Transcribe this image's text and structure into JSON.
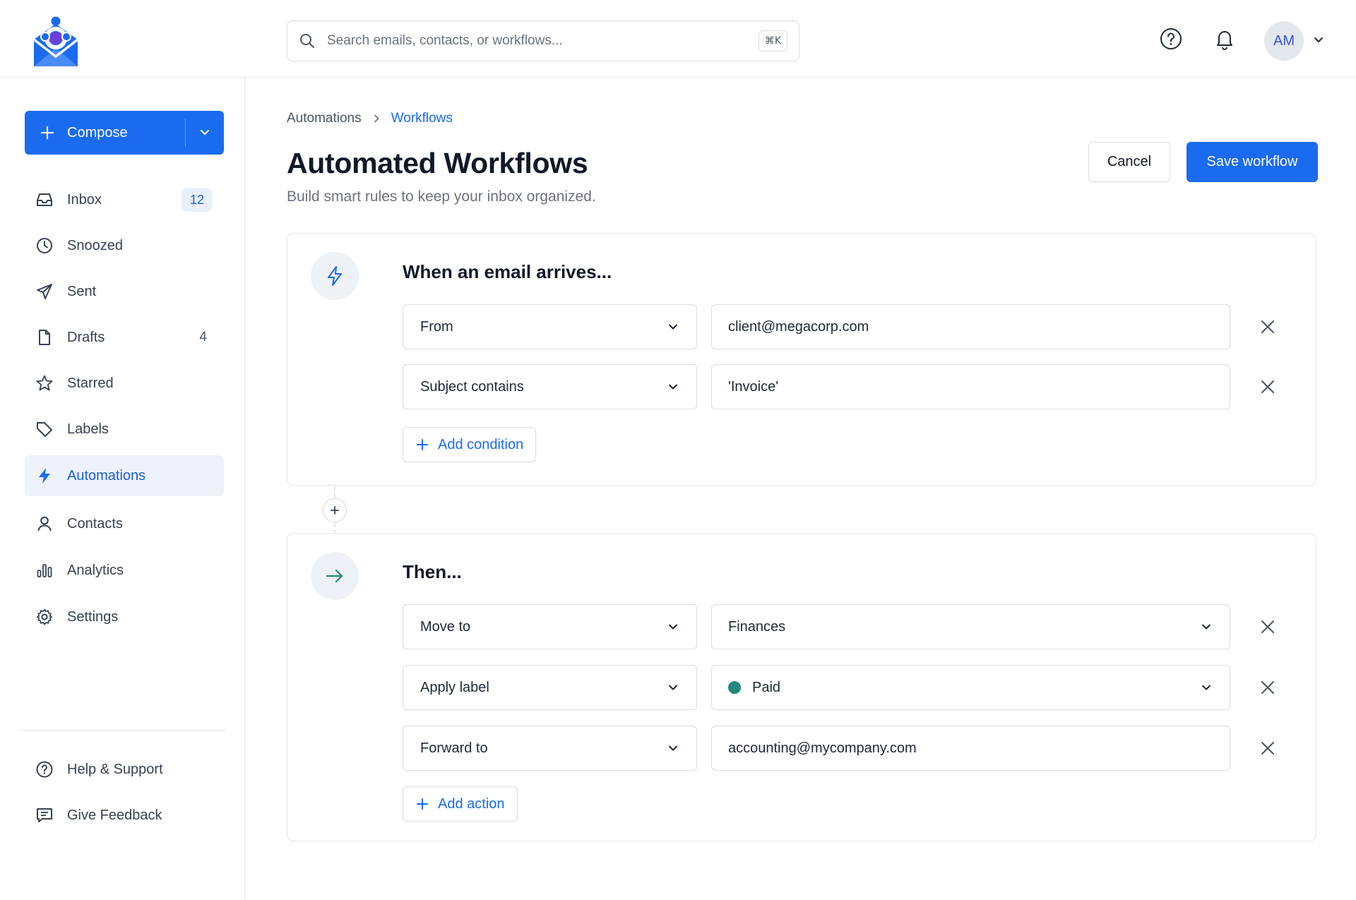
{
  "colors": {
    "accent": "#1a6bf0",
    "active_nav_bg": "#eef2fb",
    "label_paid": "#1f8a7a",
    "then_icon": "#1f8a7a"
  },
  "header": {
    "logo_icon": "envelope-people-logo",
    "search": {
      "placeholder": "Search emails, contacts, or workflows...",
      "shortcut": "⌘K"
    },
    "help_icon": "help-circle-icon",
    "notifications_icon": "bell-icon",
    "avatar_initials": "AM"
  },
  "sidebar": {
    "compose_label": "Compose",
    "items": [
      {
        "label": "Inbox",
        "icon": "inbox-icon",
        "badge": "12"
      },
      {
        "label": "Snoozed",
        "icon": "clock-icon"
      },
      {
        "label": "Sent",
        "icon": "send-icon"
      },
      {
        "label": "Drafts",
        "icon": "file-icon",
        "count": "4"
      },
      {
        "label": "Starred",
        "icon": "star-icon"
      },
      {
        "label": "Labels",
        "icon": "tag-icon"
      },
      {
        "label": "Automations",
        "icon": "bolt-icon",
        "active": true
      },
      {
        "label": "Contacts",
        "icon": "user-icon"
      },
      {
        "label": "Analytics",
        "icon": "bar-chart-icon"
      },
      {
        "label": "Settings",
        "icon": "gear-icon"
      }
    ],
    "footer": [
      {
        "label": "Help & Support",
        "icon": "help-circle-icon"
      },
      {
        "label": "Give Feedback",
        "icon": "message-icon"
      }
    ]
  },
  "main": {
    "breadcrumb": [
      "Automations",
      "Workflows"
    ],
    "title": "Automated Workflows",
    "subtitle": "Build smart rules to keep your inbox organized.",
    "cancel_label": "Cancel",
    "save_label": "Save workflow",
    "trigger": {
      "title": "When an email arrives...",
      "conditions": [
        {
          "field": "From",
          "value": "client@megacorp.com"
        },
        {
          "field": "Subject contains",
          "value": "'Invoice'"
        }
      ],
      "add_label": "Add condition"
    },
    "actions": {
      "title": "Then...",
      "items": [
        {
          "action": "Move to",
          "value": "Finances"
        },
        {
          "action": "Apply label",
          "value": "Paid"
        },
        {
          "action": "Forward to",
          "value": "accounting@mycompany.com"
        }
      ],
      "add_label": "Add action"
    }
  }
}
